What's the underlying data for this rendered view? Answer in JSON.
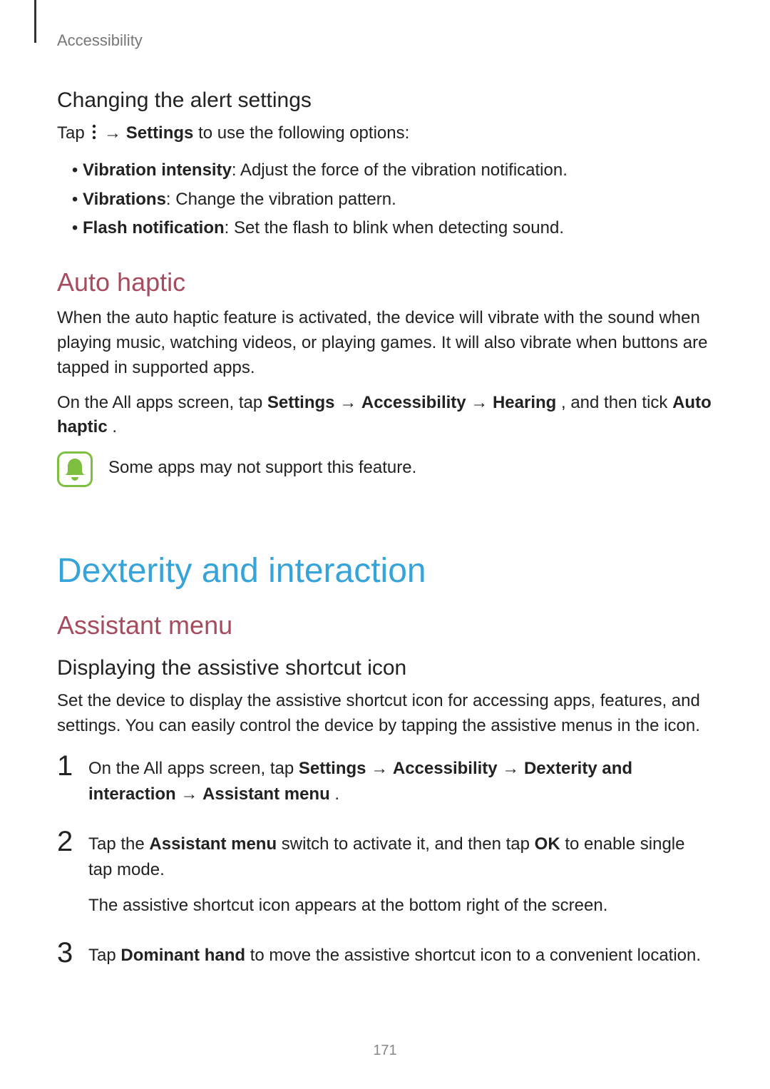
{
  "breadcrumb": "Accessibility",
  "alert": {
    "heading": "Changing the alert settings",
    "intro_pre": "Tap ",
    "intro_mid": " → ",
    "intro_bold": "Settings",
    "intro_post": " to use the following options:",
    "items": [
      {
        "name": "Vibration intensity",
        "desc": ": Adjust the force of the vibration notification."
      },
      {
        "name": "Vibrations",
        "desc": ": Change the vibration pattern."
      },
      {
        "name": "Flash notification",
        "desc": ": Set the flash to blink when detecting sound."
      }
    ]
  },
  "autohaptic": {
    "heading": "Auto haptic",
    "p1": "When the auto haptic feature is activated, the device will vibrate with the sound when playing music, watching videos, or playing games. It will also vibrate when buttons are tapped in supported apps.",
    "p2_pre": "On the All apps screen, tap ",
    "p2_b1": "Settings",
    "p2_arr1": " → ",
    "p2_b2": "Accessibility",
    "p2_arr2": " → ",
    "p2_b3": "Hearing",
    "p2_mid": ", and then tick ",
    "p2_b4": "Auto haptic",
    "p2_end": ".",
    "note": "Some apps may not support this feature."
  },
  "dexterity": {
    "heading": "Dexterity and interaction",
    "sub": "Assistant menu",
    "h3": "Displaying the assistive shortcut icon",
    "intro": "Set the device to display the assistive shortcut icon for accessing apps, features, and settings. You can easily control the device by tapping the assistive menus in the icon.",
    "steps": {
      "s1_pre": "On the All apps screen, tap ",
      "s1_b1": "Settings",
      "s1_a1": " → ",
      "s1_b2": "Accessibility",
      "s1_a2": " → ",
      "s1_b3": "Dexterity and interaction",
      "s1_a3": " → ",
      "s1_b4": "Assistant menu",
      "s1_end": ".",
      "s2_pre": "Tap the ",
      "s2_b1": "Assistant menu",
      "s2_mid": " switch to activate it, and then tap ",
      "s2_b2": "OK",
      "s2_post": " to enable single tap mode.",
      "s2_sub": "The assistive shortcut icon appears at the bottom right of the screen.",
      "s3_pre": "Tap ",
      "s3_b1": "Dominant hand",
      "s3_post": " to move the assistive shortcut icon to a convenient location."
    }
  },
  "pageNumber": "171"
}
